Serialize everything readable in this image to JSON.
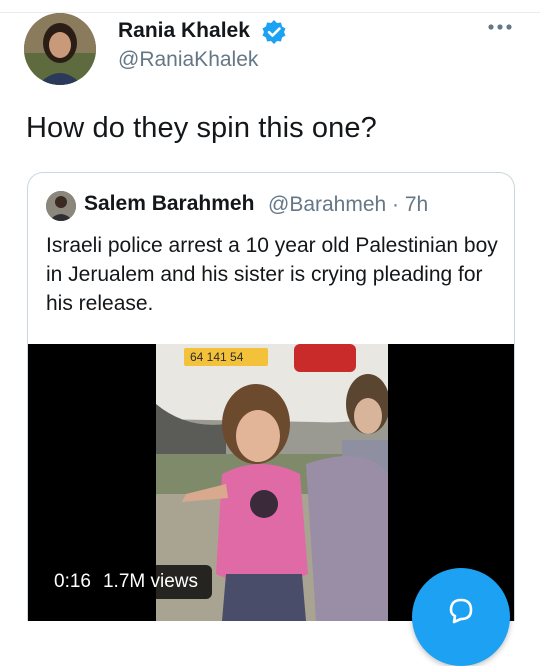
{
  "tweet": {
    "author": {
      "name": "Rania Khalek",
      "handle": "@RaniaKhalek",
      "verified": true
    },
    "text": "How do they spin this one?",
    "quoted_tweet": {
      "author_name": "Salem Barahmeh",
      "author_handle": "@Barahmeh · 7h",
      "text": "Israeli police arrest a 10 year old Palestinian boy in Jerualem and his sister is crying pleading for his release.",
      "media": {
        "duration": "0:16",
        "views": "1.7M views",
        "license_plate_text": "64 141 54"
      }
    }
  },
  "icons": {
    "verified": "verified-badge-icon",
    "more": "more-dots-icon",
    "compose": "compose-icon"
  },
  "colors": {
    "accent": "#1da1f2",
    "secondary_text": "#657786",
    "border": "#ccd6dd"
  }
}
